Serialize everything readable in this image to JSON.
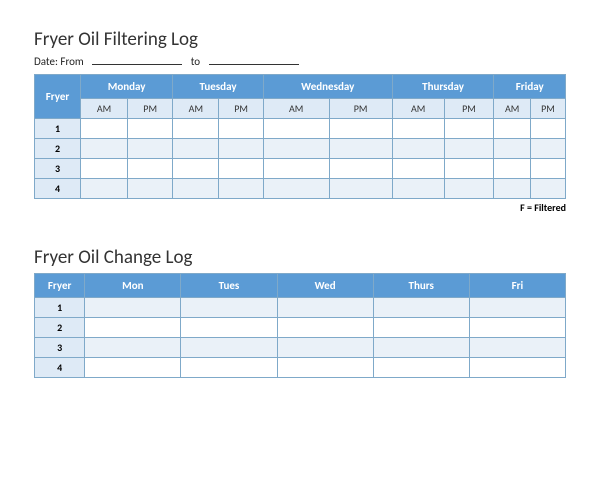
{
  "filtering": {
    "title": "Fryer Oil Filtering Log",
    "date_from_label": "Date: From",
    "date_to_label": "to",
    "columns": {
      "fryer": "Fryer"
    },
    "days": [
      "Monday",
      "Tuesday",
      "Wednesday",
      "Thursday",
      "Friday"
    ],
    "subcols": [
      "AM",
      "PM"
    ],
    "rows": [
      "1",
      "2",
      "3",
      "4"
    ],
    "footnote": "F = Filtered"
  },
  "change": {
    "title": "Fryer Oil Change Log",
    "columns": {
      "fryer": "Fryer"
    },
    "days": [
      "Mon",
      "Tues",
      "Wed",
      "Thurs",
      "Fri"
    ],
    "rows": [
      "1",
      "2",
      "3",
      "4"
    ]
  }
}
